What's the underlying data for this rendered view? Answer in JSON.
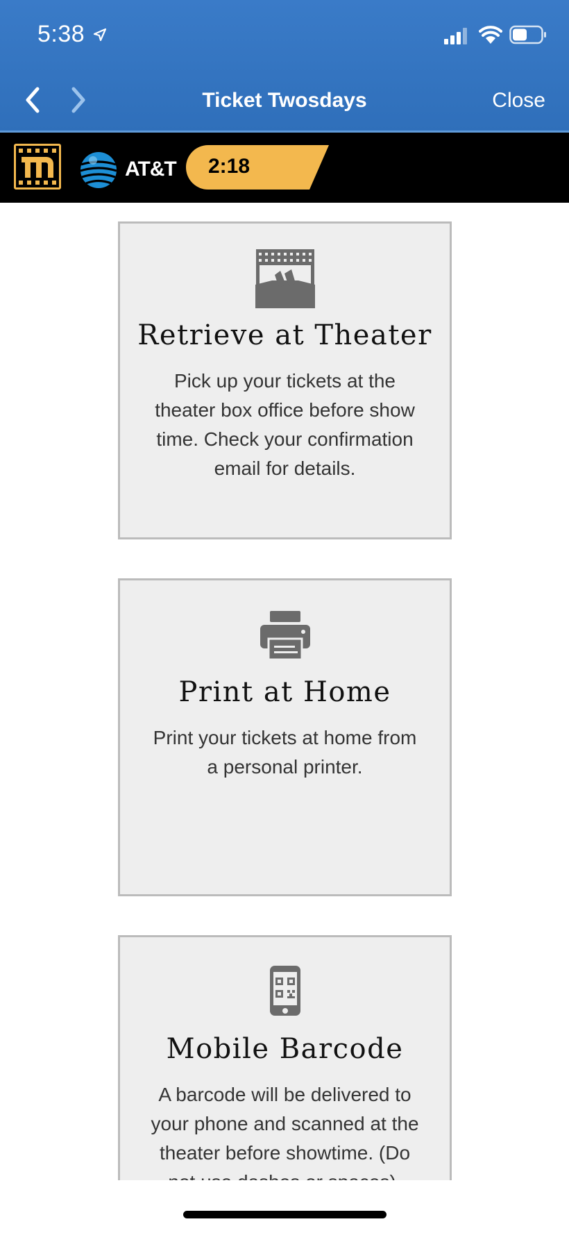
{
  "status_bar": {
    "time": "5:38"
  },
  "nav": {
    "title": "Ticket Twosdays",
    "close_label": "Close"
  },
  "brand_bar": {
    "carrier_label": "AT&T",
    "timer": "2:18",
    "accent_color": "#f3b84e"
  },
  "cards": [
    {
      "icon": "theater-ticket-icon",
      "title": "Retrieve at Theater",
      "desc_lines": [
        "Pick up your tickets at the",
        "theater box office before show",
        "time. Check your confirmation",
        "email for details."
      ]
    },
    {
      "icon": "printer-icon",
      "title": "Print at Home",
      "desc_lines": [
        "Print your tickets at home from",
        "a personal printer."
      ]
    },
    {
      "icon": "mobile-barcode-icon",
      "title": "Mobile Barcode",
      "desc_lines": [
        "A barcode will be delivered to",
        "your phone and scanned at the",
        "theater before showtime. (Do",
        "not use dashes or spaces)."
      ]
    }
  ]
}
